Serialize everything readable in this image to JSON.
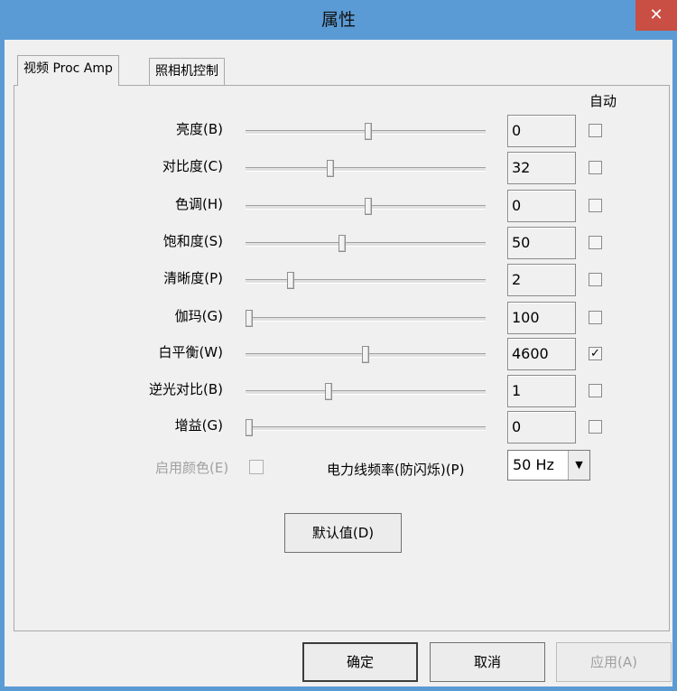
{
  "window": {
    "title": "属性",
    "close_glyph": "✕"
  },
  "tabs": [
    {
      "label": "视频 Proc Amp",
      "active": true
    },
    {
      "label": "照相机控制",
      "active": false
    }
  ],
  "auto_header": "自动",
  "controls": [
    {
      "label": "亮度(B)",
      "value": "0",
      "slider_fraction": 0.51,
      "auto": false
    },
    {
      "label": "对比度(C)",
      "value": "32",
      "slider_fraction": 0.35,
      "auto": false
    },
    {
      "label": "色调(H)",
      "value": "0",
      "slider_fraction": 0.51,
      "auto": false
    },
    {
      "label": "饱和度(S)",
      "value": "50",
      "slider_fraction": 0.4,
      "auto": false
    },
    {
      "label": "清晰度(P)",
      "value": "2",
      "slider_fraction": 0.18,
      "auto": false
    },
    {
      "label": "伽玛(G)",
      "value": "100",
      "slider_fraction": 0.0,
      "auto": false
    },
    {
      "label": "白平衡(W)",
      "value": "4600",
      "slider_fraction": 0.5,
      "auto": true
    },
    {
      "label": "逆光对比(B)",
      "value": "1",
      "slider_fraction": 0.34,
      "auto": false
    },
    {
      "label": "增益(G)",
      "value": "0",
      "slider_fraction": 0.0,
      "auto": false
    }
  ],
  "enable_color": {
    "label": "启用颜色(E)",
    "checked": false,
    "disabled": true
  },
  "power_line": {
    "label": "电力线频率(防闪烁)(P)",
    "selected": "50 Hz",
    "arrow": "▼"
  },
  "default_button": "默认值(D)",
  "footer": {
    "ok": "确定",
    "cancel": "取消",
    "apply": "应用(A)"
  },
  "check_glyph": "✓"
}
